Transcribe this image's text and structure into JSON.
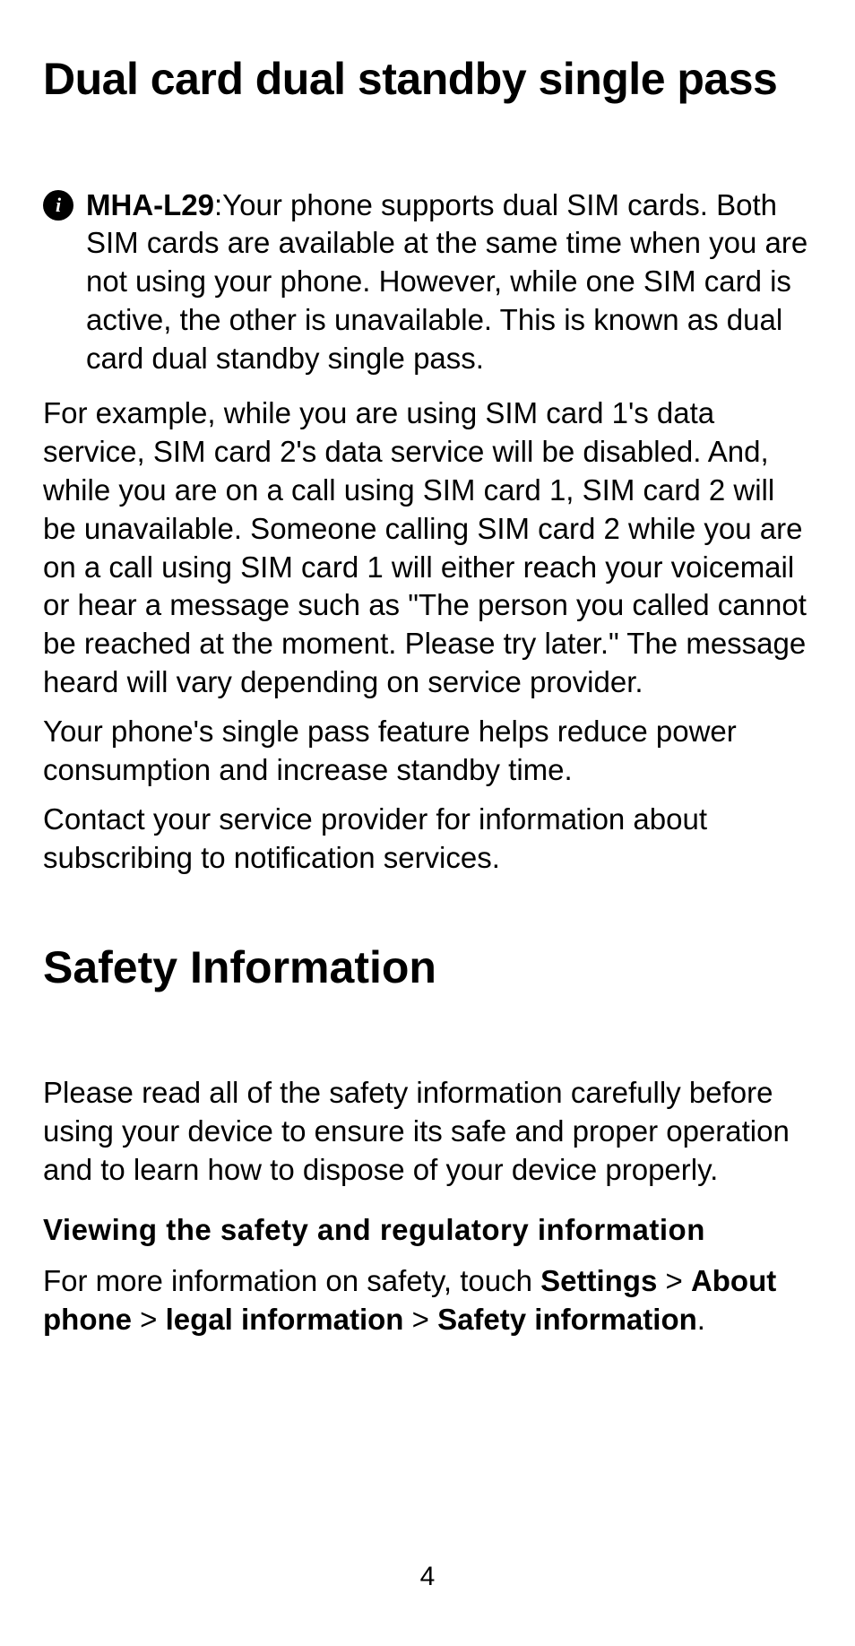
{
  "heading1": "Dual card dual standby single pass",
  "info": {
    "icon_glyph": "i",
    "model": "MHA-L29",
    "body": ":Your phone supports dual SIM cards. Both SIM cards are available at the same time when you are not using your phone. However, while one SIM card is active, the other is unavailable. This is known as dual card dual standby single pass."
  },
  "paragraphs": {
    "p1": "For example, while you are using SIM card 1's data service, SIM card 2's data service will be disabled. And, while you are on a call using SIM card 1, SIM card 2 will be unavailable. Someone calling SIM card 2 while you are on a call using SIM card 1 will either reach your voicemail or hear a message such as \"The person you called cannot be reached at the moment. Please try later.\" The message heard will vary depending on service provider.",
    "p2": "Your phone's single pass feature helps reduce power consumption and increase standby time.",
    "p3": "Contact your service provider for information about subscribing to notification services."
  },
  "heading2": "Safety Information",
  "safety_intro": "Please read all of the safety information carefully before using your device to ensure its safe and proper operation and to learn how to dispose of your device properly.",
  "heading3": "Viewing the safety and regulatory information",
  "nav": {
    "prefix": "For more information on safety, touch ",
    "sep": " > ",
    "steps": [
      "Settings",
      "About phone",
      "legal information",
      "Safety information"
    ],
    "suffix": "."
  },
  "page_number": "4"
}
